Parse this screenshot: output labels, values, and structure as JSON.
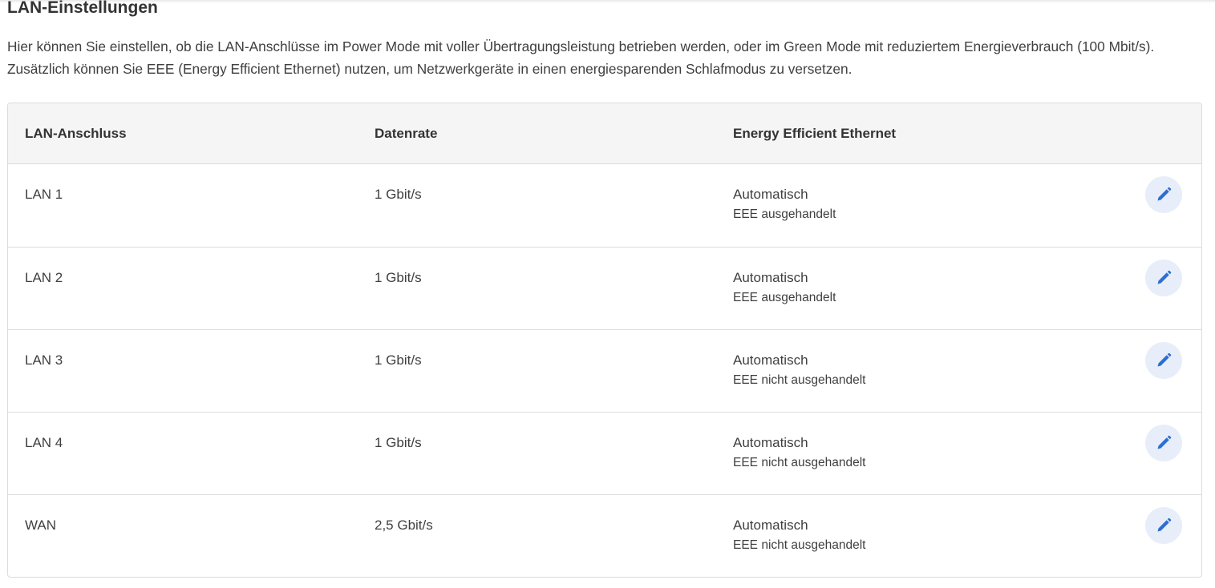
{
  "title": "LAN-Einstellungen",
  "intro": "Hier können Sie einstellen, ob die LAN-Anschlüsse im Power Mode mit voller Übertragungsleistung betrieben werden, oder im Green Mode mit reduziertem Energieverbrauch (100 Mbit/s). Zusätzlich können Sie EEE (Energy Efficient Ethernet) nutzen, um Netzwerkgeräte in einen energiesparenden Schlafmodus zu versetzen.",
  "table": {
    "headers": [
      "LAN-Anschluss",
      "Datenrate",
      "Energy Efficient Ethernet"
    ],
    "rows": [
      {
        "port": "LAN 1",
        "rate": "1 Gbit/s",
        "eee": "Automatisch",
        "eee_status": "EEE ausgehandelt",
        "edit_icon": "pencil-icon"
      },
      {
        "port": "LAN 2",
        "rate": "1 Gbit/s",
        "eee": "Automatisch",
        "eee_status": "EEE ausgehandelt",
        "edit_icon": "pencil-icon"
      },
      {
        "port": "LAN 3",
        "rate": "1 Gbit/s",
        "eee": "Automatisch",
        "eee_status": "EEE nicht ausgehandelt",
        "edit_icon": "pencil-icon"
      },
      {
        "port": "LAN 4",
        "rate": "1 Gbit/s",
        "eee": "Automatisch",
        "eee_status": "EEE nicht ausgehandelt",
        "edit_icon": "pencil-icon"
      },
      {
        "port": "WAN",
        "rate": "2,5 Gbit/s",
        "eee": "Automatisch",
        "eee_status": "EEE nicht ausgehandelt",
        "edit_icon": "pencil-icon"
      }
    ]
  },
  "colors": {
    "accent": "#2d6fd1",
    "edit_button_bg": "#e7eef9",
    "header_bg": "#f4f5f4",
    "border": "#dcdcdc"
  }
}
